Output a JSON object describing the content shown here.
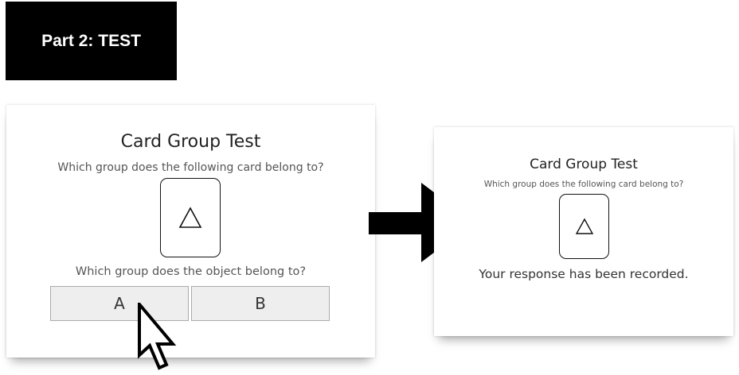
{
  "badge": {
    "label": "Part 2: TEST"
  },
  "test_screen": {
    "title": "Card Group Test",
    "question": "Which group does the following card belong to?",
    "card_symbol": "triangle-outline-icon",
    "object_question": "Which group does the object belong to?",
    "choices": [
      {
        "label": "A"
      },
      {
        "label": "B"
      }
    ]
  },
  "result_screen": {
    "title": "Card Group Test",
    "question": "Which group does the following card belong to?",
    "card_symbol": "triangle-outline-icon",
    "status": "Your response has been recorded."
  },
  "colors": {
    "badge_bg": "#000000",
    "choice_bg": "#eeeeee",
    "text": "#333333"
  }
}
